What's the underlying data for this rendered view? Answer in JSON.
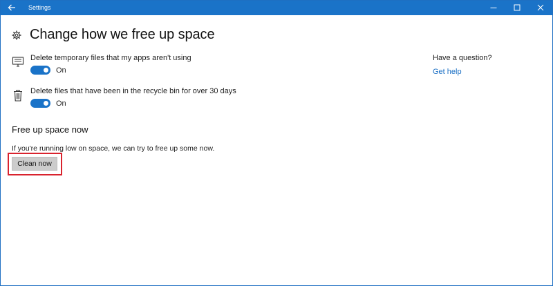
{
  "titlebar": {
    "title": "Settings",
    "back_icon": "arrow-left-icon",
    "controls": [
      "minimize-icon",
      "maximize-icon",
      "close-icon"
    ]
  },
  "header": {
    "icon": "gear-icon",
    "title": "Change how we free up space"
  },
  "settings": [
    {
      "icon": "monitor-icon",
      "label": "Delete temporary files that my apps aren't using",
      "toggle_on": true,
      "state_label": "On"
    },
    {
      "icon": "trash-icon",
      "label": "Delete files that have been in the recycle bin for over 30 days",
      "toggle_on": true,
      "state_label": "On"
    }
  ],
  "free_up": {
    "title": "Free up space now",
    "description": "If you're running low on space, we can try to free up some now.",
    "button_label": "Clean now"
  },
  "side_panel": {
    "question": "Have a question?",
    "link": "Get help"
  },
  "colors": {
    "accent": "#1a73c8",
    "highlight": "#d9232e",
    "button_bg": "#cccccc"
  }
}
